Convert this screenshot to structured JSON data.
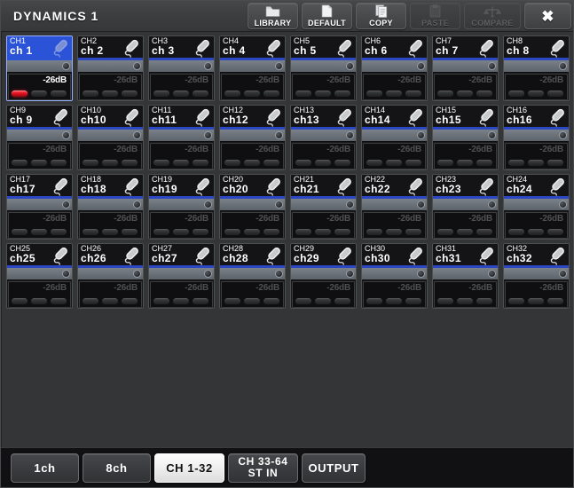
{
  "window": {
    "title": "DYNAMICS 1"
  },
  "toolbar": {
    "library_label": "LIBRARY",
    "default_label": "DEFAULT",
    "copy_label": "COPY",
    "paste_label": "PASTE",
    "compare_label": "COMPARE",
    "close_label": "✖"
  },
  "colors": {
    "selected_blue": "#2b53d8",
    "header_underline": "#2b47c4",
    "led_red": "#e5121f",
    "window_bg": "#343537",
    "titlebar_bg": "#3c3d3f"
  },
  "channels": [
    {
      "id": "CH1",
      "name": "ch 1",
      "db": "-26dB",
      "selected": true,
      "leds": [
        true,
        false,
        false
      ]
    },
    {
      "id": "CH2",
      "name": "ch 2",
      "db": "-26dB",
      "selected": false,
      "leds": [
        false,
        false,
        false
      ]
    },
    {
      "id": "CH3",
      "name": "ch 3",
      "db": "-26dB",
      "selected": false,
      "leds": [
        false,
        false,
        false
      ]
    },
    {
      "id": "CH4",
      "name": "ch 4",
      "db": "-26dB",
      "selected": false,
      "leds": [
        false,
        false,
        false
      ]
    },
    {
      "id": "CH5",
      "name": "ch 5",
      "db": "-26dB",
      "selected": false,
      "leds": [
        false,
        false,
        false
      ]
    },
    {
      "id": "CH6",
      "name": "ch 6",
      "db": "-26dB",
      "selected": false,
      "leds": [
        false,
        false,
        false
      ]
    },
    {
      "id": "CH7",
      "name": "ch 7",
      "db": "-26dB",
      "selected": false,
      "leds": [
        false,
        false,
        false
      ]
    },
    {
      "id": "CH8",
      "name": "ch 8",
      "db": "-26dB",
      "selected": false,
      "leds": [
        false,
        false,
        false
      ]
    },
    {
      "id": "CH9",
      "name": "ch 9",
      "db": "-26dB",
      "selected": false,
      "leds": [
        false,
        false,
        false
      ]
    },
    {
      "id": "CH10",
      "name": "ch10",
      "db": "-26dB",
      "selected": false,
      "leds": [
        false,
        false,
        false
      ]
    },
    {
      "id": "CH11",
      "name": "ch11",
      "db": "-26dB",
      "selected": false,
      "leds": [
        false,
        false,
        false
      ]
    },
    {
      "id": "CH12",
      "name": "ch12",
      "db": "-26dB",
      "selected": false,
      "leds": [
        false,
        false,
        false
      ]
    },
    {
      "id": "CH13",
      "name": "ch13",
      "db": "-26dB",
      "selected": false,
      "leds": [
        false,
        false,
        false
      ]
    },
    {
      "id": "CH14",
      "name": "ch14",
      "db": "-26dB",
      "selected": false,
      "leds": [
        false,
        false,
        false
      ]
    },
    {
      "id": "CH15",
      "name": "ch15",
      "db": "-26dB",
      "selected": false,
      "leds": [
        false,
        false,
        false
      ]
    },
    {
      "id": "CH16",
      "name": "ch16",
      "db": "-26dB",
      "selected": false,
      "leds": [
        false,
        false,
        false
      ]
    },
    {
      "id": "CH17",
      "name": "ch17",
      "db": "-26dB",
      "selected": false,
      "leds": [
        false,
        false,
        false
      ]
    },
    {
      "id": "CH18",
      "name": "ch18",
      "db": "-26dB",
      "selected": false,
      "leds": [
        false,
        false,
        false
      ]
    },
    {
      "id": "CH19",
      "name": "ch19",
      "db": "-26dB",
      "selected": false,
      "leds": [
        false,
        false,
        false
      ]
    },
    {
      "id": "CH20",
      "name": "ch20",
      "db": "-26dB",
      "selected": false,
      "leds": [
        false,
        false,
        false
      ]
    },
    {
      "id": "CH21",
      "name": "ch21",
      "db": "-26dB",
      "selected": false,
      "leds": [
        false,
        false,
        false
      ]
    },
    {
      "id": "CH22",
      "name": "ch22",
      "db": "-26dB",
      "selected": false,
      "leds": [
        false,
        false,
        false
      ]
    },
    {
      "id": "CH23",
      "name": "ch23",
      "db": "-26dB",
      "selected": false,
      "leds": [
        false,
        false,
        false
      ]
    },
    {
      "id": "CH24",
      "name": "ch24",
      "db": "-26dB",
      "selected": false,
      "leds": [
        false,
        false,
        false
      ]
    },
    {
      "id": "CH25",
      "name": "ch25",
      "db": "-26dB",
      "selected": false,
      "leds": [
        false,
        false,
        false
      ]
    },
    {
      "id": "CH26",
      "name": "ch26",
      "db": "-26dB",
      "selected": false,
      "leds": [
        false,
        false,
        false
      ]
    },
    {
      "id": "CH27",
      "name": "ch27",
      "db": "-26dB",
      "selected": false,
      "leds": [
        false,
        false,
        false
      ]
    },
    {
      "id": "CH28",
      "name": "ch28",
      "db": "-26dB",
      "selected": false,
      "leds": [
        false,
        false,
        false
      ]
    },
    {
      "id": "CH29",
      "name": "ch29",
      "db": "-26dB",
      "selected": false,
      "leds": [
        false,
        false,
        false
      ]
    },
    {
      "id": "CH30",
      "name": "ch30",
      "db": "-26dB",
      "selected": false,
      "leds": [
        false,
        false,
        false
      ]
    },
    {
      "id": "CH31",
      "name": "ch31",
      "db": "-26dB",
      "selected": false,
      "leds": [
        false,
        false,
        false
      ]
    },
    {
      "id": "CH32",
      "name": "ch32",
      "db": "-26dB",
      "selected": false,
      "leds": [
        false,
        false,
        false
      ]
    }
  ],
  "tabs": [
    {
      "label": "1ch",
      "active": false,
      "width": "w1"
    },
    {
      "label": "8ch",
      "active": false,
      "width": "w2"
    },
    {
      "label": "CH 1-32",
      "active": true,
      "width": "w3"
    },
    {
      "label": "CH 33-64\nST IN",
      "active": false,
      "width": "w4"
    },
    {
      "label": "OUTPUT",
      "active": false,
      "width": "w5"
    }
  ],
  "icons": {
    "library": "folder-icon",
    "default": "page-icon",
    "copy": "copy-icon",
    "paste": "clipboard-icon",
    "compare": "compare-icon",
    "channel": "microphone-icon",
    "knob": "knob-icon"
  }
}
